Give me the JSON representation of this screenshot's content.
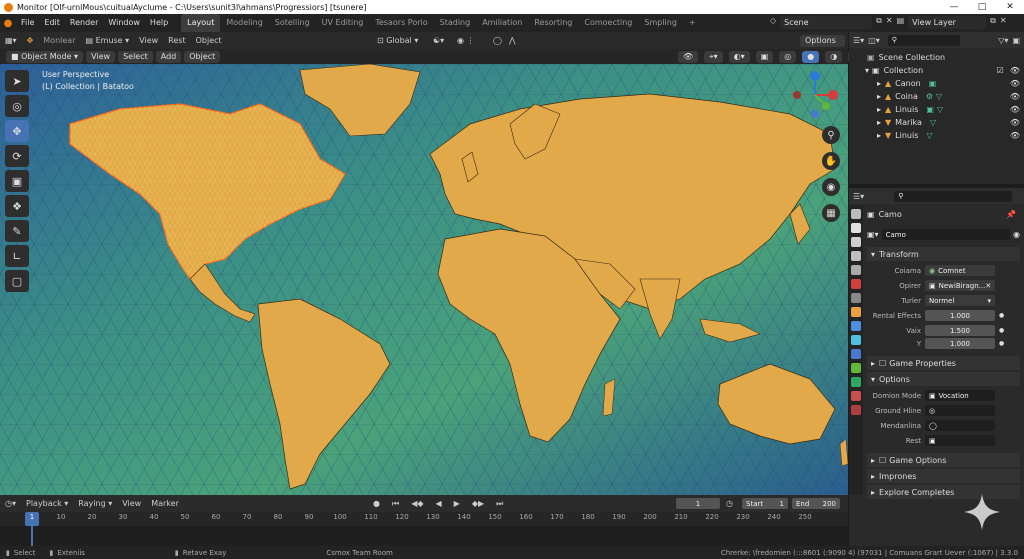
{
  "window": {
    "title": "Monitor [Olf-urnlMous\\cuitualAyclume - C:\\Users\\sunit3l\\ahmans\\Progressiors] [tsunere]"
  },
  "menu": [
    "File",
    "Edit",
    "Render",
    "Window",
    "Help"
  ],
  "workspaces": [
    "Layout",
    "Modeling",
    "Sotelling",
    "UV Editing",
    "Tesaors Porio",
    "Stading",
    "Amiliation",
    "Resorting",
    "Comoecting",
    "Smpling"
  ],
  "topright": {
    "scene": "Scene",
    "view_layer": "View Layer"
  },
  "viewport_header": {
    "mode_label": "Monlear",
    "transform_label": "Emuse",
    "view": "View",
    "rest": "Rest",
    "object": "Object",
    "orientation": "Global",
    "options": "Options"
  },
  "viewport_header2": {
    "mode": "Object Mode",
    "view": "View",
    "select": "Select",
    "add": "Add",
    "object": "Object"
  },
  "viewport_overlay": {
    "perspective": "User Perspective",
    "collection": "(L) Collection | Batatoo"
  },
  "toolbar_icons": [
    "select-cursor-icon",
    "cursor-icon",
    "move-icon",
    "rotate-icon",
    "scale-icon",
    "transform-icon",
    "annotate-icon",
    "measure-icon",
    "add-cube-icon"
  ],
  "outliner": {
    "scene_collection": "Scene Collection",
    "collection": "Collection",
    "items": [
      "Canon",
      "Coina",
      "Linuis",
      "Marika",
      "Linuis"
    ]
  },
  "properties": {
    "object_name": "Camo",
    "data_name": "Camo",
    "transform_header": "Transform",
    "fields": [
      {
        "label": "Coiama",
        "value": "Comnet"
      },
      {
        "label": "Opirer",
        "value": "NewiBiragn..."
      },
      {
        "label": "Turler",
        "value": "Normel"
      },
      {
        "label": "Rental Effects",
        "value": "1.000"
      },
      {
        "label": "Vaix",
        "value": "1.500"
      },
      {
        "label": "Y",
        "value": "1.000"
      }
    ],
    "game_properties": "Game Properties",
    "options_header": "Options",
    "option_fields": [
      {
        "label": "Domion Mode",
        "value": "Vocation"
      },
      {
        "label": "Ground Hline",
        "value": ""
      },
      {
        "label": "Mendanlina",
        "value": ""
      },
      {
        "label": "Rest",
        "value": ""
      }
    ],
    "game_options": "Game Options",
    "imprones": "Imprones",
    "explore": "Explore Completes"
  },
  "timeline": {
    "playback": "Playback",
    "keying": "Raying",
    "view": "View",
    "marker": "Marker",
    "current_frame": "1",
    "start_label": "Start",
    "start": "1",
    "end_label": "End",
    "end": "200",
    "ticks": [
      "1",
      "10",
      "20",
      "30",
      "40",
      "50",
      "60",
      "70",
      "80",
      "90",
      "100",
      "110",
      "120",
      "130",
      "140",
      "150",
      "160",
      "170",
      "180",
      "190",
      "200",
      "210",
      "220",
      "230",
      "240",
      "250"
    ]
  },
  "statusbar": {
    "select": "Select",
    "extend": "Exteniis",
    "rotate": "Retave Exay",
    "team": "Csmox Team Room",
    "stats": "Chrerke: \\fredomien (:::8601 (:9090 4) (97031 | Comuans Grart Uever (:1067) | 3.3.0"
  },
  "colors": {
    "accent": "#4772b3",
    "land": "#e2a94a",
    "ocean_deep": "#1f3f8a",
    "ocean_shallow": "#3fa07a",
    "mesh_hot": "#ff5a1a"
  }
}
